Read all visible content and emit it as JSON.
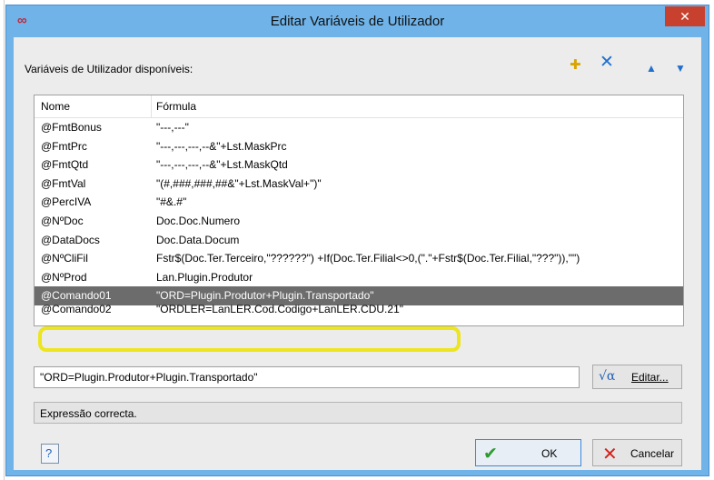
{
  "window": {
    "title": "Editar Variáveis de Utilizador",
    "app_icon": "∞",
    "close_glyph": "✕"
  },
  "toolbar": {
    "label": "Variáveis de Utilizador disponíveis:",
    "icons": [
      "new-variable-icon",
      "delete-icon",
      "move-up-icon",
      "move-down-icon"
    ]
  },
  "table": {
    "headers": {
      "name": "Nome",
      "formula": "Fórmula"
    },
    "rows": [
      {
        "name": "@FmtBonus",
        "formula": "\"---,---\""
      },
      {
        "name": "@FmtPrc",
        "formula": "\"---,---,---,--&\"+Lst.MaskPrc"
      },
      {
        "name": "@FmtQtd",
        "formula": "\"---,---,---,--&\"+Lst.MaskQtd"
      },
      {
        "name": "@FmtVal",
        "formula": "\"(#,###,###,##&\"+Lst.MaskVal+\")\""
      },
      {
        "name": "@PercIVA",
        "formula": "\"#&.#\""
      },
      {
        "name": "@NºDoc",
        "formula": "Doc.Doc.Numero"
      },
      {
        "name": "@DataDocs",
        "formula": "Doc.Data.Docum"
      },
      {
        "name": "@NºCliFil",
        "formula": "Fstr$(Doc.Ter.Terceiro,\"??????\") +If(Doc.Ter.Filial<>0,(\".\"+Fstr$(Doc.Ter.Filial,\"???\")),\"\")"
      },
      {
        "name": "@NºProd",
        "formula": "Lan.Plugin.Produtor"
      },
      {
        "name": "@Comando01",
        "formula": "\"ORD=Plugin.Produtor+Plugin.Transportado\"",
        "selected": true
      },
      {
        "name": "@Comando02",
        "formula": "\"ORDLER=LanLER.Cod.Codigo+LanLER.CDU.21\""
      }
    ]
  },
  "expression": {
    "value": "\"ORD=Plugin.Produtor+Plugin.Transportado\"",
    "edit_button": "Editar...",
    "sqrt_glyph": "√α"
  },
  "status": {
    "text": "Expressão correcta."
  },
  "footer": {
    "help_glyph": "?",
    "ok_label": "OK",
    "cancel_label": "Cancelar"
  },
  "colors": {
    "title_bar": "#6fb3e8",
    "close_button": "#c7412e",
    "selected_row": "#6c6c6c",
    "highlight_annotation": "#ece51f"
  }
}
